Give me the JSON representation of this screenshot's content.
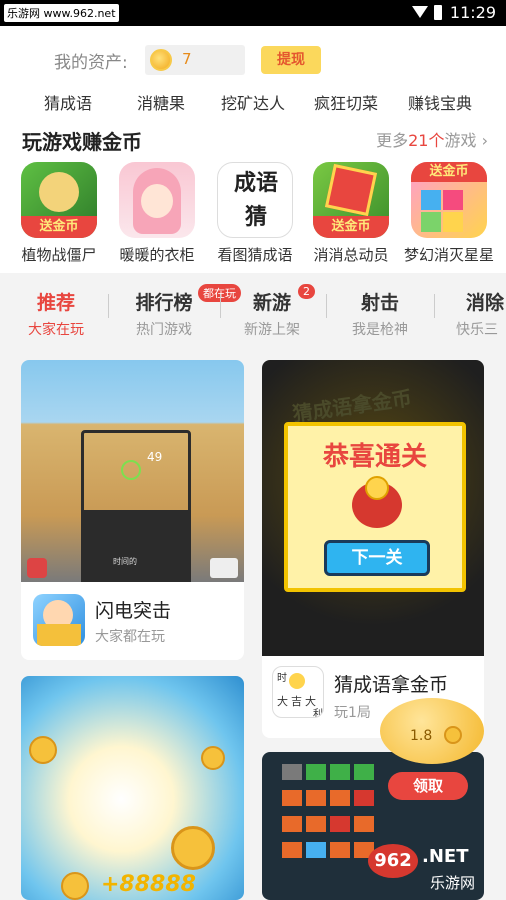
{
  "status_bar": {
    "source": "乐游网 www.962.net",
    "time": "11:29"
  },
  "assets": {
    "label": "我的资产:",
    "value": "7",
    "withdraw_label": "提现"
  },
  "quick_links": [
    "猜成语",
    "消糖果",
    "挖矿达人",
    "疯狂切菜",
    "赚钱宝典"
  ],
  "section": {
    "title": "玩游戏赚金币",
    "more_prefix": "更多",
    "more_count": "21个",
    "more_suffix": "游戏",
    "games": [
      {
        "name": "植物战僵尸",
        "badge": "送金币"
      },
      {
        "name": "暖暖的衣柜"
      },
      {
        "name": "看图猜成语",
        "icon_text": "成语 猜"
      },
      {
        "name": "消消总动员",
        "badge": "送金币"
      },
      {
        "name": "梦幻消灭星星",
        "badge": "送金币"
      }
    ]
  },
  "tabs": [
    {
      "title": "推荐",
      "sub": "大家在玩",
      "active": true
    },
    {
      "title": "排行榜",
      "sub": "热门游戏",
      "badge": "都在玩"
    },
    {
      "title": "新游",
      "sub": "新游上架",
      "badge": "2"
    },
    {
      "title": "射击",
      "sub": "我是枪神"
    },
    {
      "title": "消除",
      "sub": "快乐三"
    }
  ],
  "cards": [
    {
      "title": "闪电突击",
      "sub": "大家都在玩",
      "hud_value": "49",
      "hud_label": "时间的"
    },
    {
      "title": "猜成语拿金币",
      "sub": "玩1局",
      "img_banner": "恭喜通关",
      "img_button": "下一关",
      "img_bg_text": "猜成语拿金币",
      "icon_chars": [
        "时",
        "大",
        "吉",
        "大",
        "利"
      ]
    },
    {
      "img_text": "+88888"
    },
    {}
  ],
  "floating_pig": {
    "value": "1.8",
    "button": "领取"
  },
  "watermark": {
    "brand": "962",
    "tld": ".NET",
    "name": "乐游网"
  },
  "colors": {
    "accent": "#e8463f",
    "gold": "#f2a81d",
    "withdraw_bg": "#fbd85c"
  }
}
